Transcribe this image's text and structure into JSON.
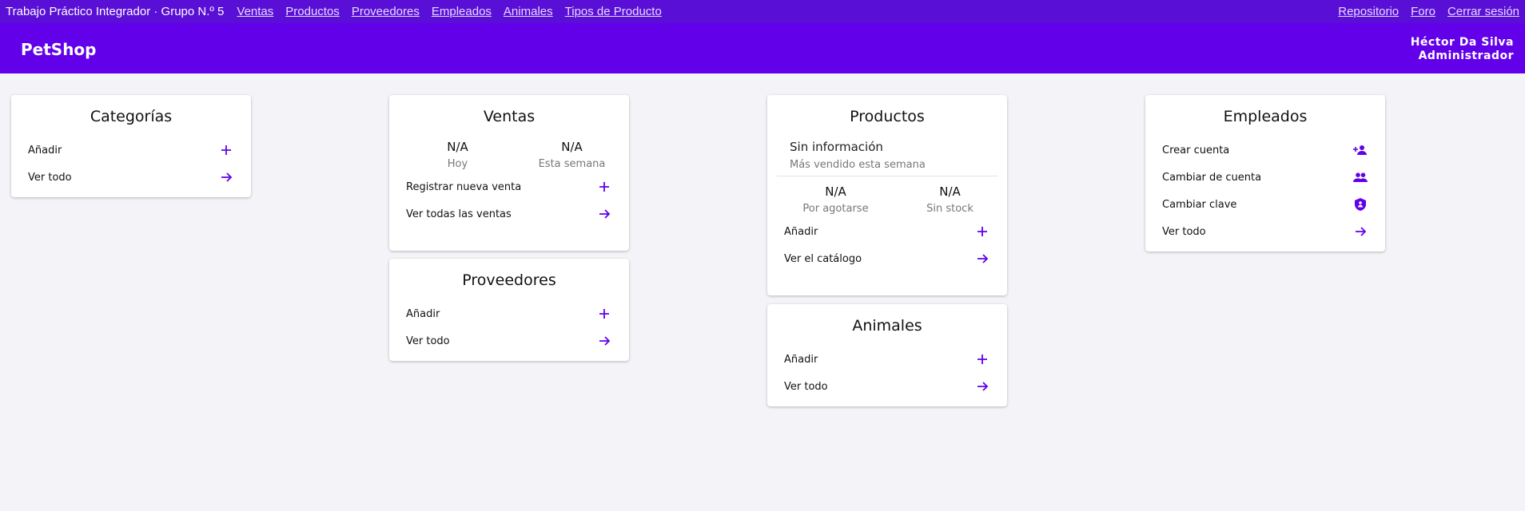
{
  "topbar": {
    "title": "Trabajo Práctico Integrador · Grupo N.º 5",
    "links": [
      "Ventas",
      "Productos",
      "Proveedores",
      "Empleados",
      "Animales",
      "Tipos de Producto"
    ],
    "right_links": [
      "Repositorio",
      "Foro",
      "Cerrar sesión"
    ]
  },
  "appbar": {
    "brand": "PetShop",
    "user_name": "Héctor Da Silva",
    "user_role": "Administrador"
  },
  "colors": {
    "accent": "#6200ea",
    "topbar": "#5a0fd6"
  },
  "categorias": {
    "title": "Categorías",
    "actions": [
      {
        "label": "Añadir",
        "icon": "plus-icon"
      },
      {
        "label": "Ver todo",
        "icon": "arrow-right-icon"
      }
    ]
  },
  "ventas": {
    "title": "Ventas",
    "stats": [
      {
        "value": "N/A",
        "label": "Hoy"
      },
      {
        "value": "N/A",
        "label": "Esta semana"
      }
    ],
    "actions": [
      {
        "label": "Registrar nueva venta",
        "icon": "plus-icon"
      },
      {
        "label": "Ver todas las ventas",
        "icon": "arrow-right-icon"
      }
    ]
  },
  "proveedores": {
    "title": "Proveedores",
    "actions": [
      {
        "label": "Añadir",
        "icon": "plus-icon"
      },
      {
        "label": "Ver todo",
        "icon": "arrow-right-icon"
      }
    ]
  },
  "productos": {
    "title": "Productos",
    "info_main": "Sin información",
    "info_sub": "Más vendido esta semana",
    "stats": [
      {
        "value": "N/A",
        "label": "Por agotarse"
      },
      {
        "value": "N/A",
        "label": "Sin stock"
      }
    ],
    "actions": [
      {
        "label": "Añadir",
        "icon": "plus-icon"
      },
      {
        "label": "Ver el catálogo",
        "icon": "arrow-right-icon"
      }
    ]
  },
  "animales": {
    "title": "Animales",
    "actions": [
      {
        "label": "Añadir",
        "icon": "plus-icon"
      },
      {
        "label": "Ver todo",
        "icon": "arrow-right-icon"
      }
    ]
  },
  "empleados": {
    "title": "Empleados",
    "actions": [
      {
        "label": "Crear cuenta",
        "icon": "person-add-icon"
      },
      {
        "label": "Cambiar de cuenta",
        "icon": "people-icon"
      },
      {
        "label": "Cambiar clave",
        "icon": "shield-icon"
      },
      {
        "label": "Ver todo",
        "icon": "arrow-right-icon"
      }
    ]
  }
}
